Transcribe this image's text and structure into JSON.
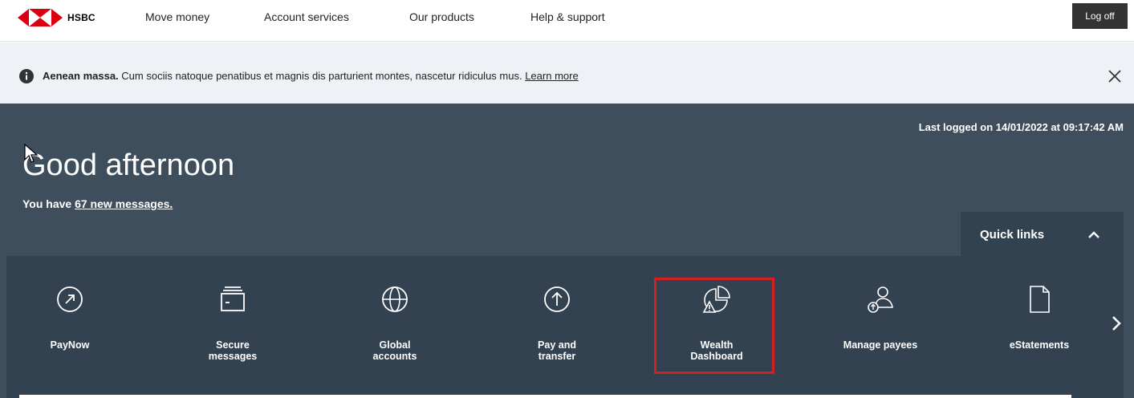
{
  "brand": {
    "name": "HSBC",
    "colors": {
      "red": "#db0011",
      "dark": "#333333",
      "hero": "#3e4e5c",
      "panel": "#334250"
    }
  },
  "nav": {
    "items": [
      {
        "label": "Move money"
      },
      {
        "label": "Account services"
      },
      {
        "label": "Our products"
      },
      {
        "label": "Help & support"
      }
    ],
    "logoff_label": "Log off"
  },
  "notice": {
    "bold_text": "Aenean massa.",
    "text": " Cum sociis natoque penatibus et magnis dis parturient montes, nascetur ridiculus mus. ",
    "link_text": "Learn more",
    "icon": "info-icon",
    "close_icon": "close-icon"
  },
  "hero": {
    "last_logged": "Last logged on 14/01/2022 at 09:17:42 AM",
    "greeting": "Good afternoon",
    "messages_prefix": "You have ",
    "messages_link": "67 new messages."
  },
  "quick_links": {
    "label": "Quick links",
    "items": [
      {
        "label": "PayNow",
        "icon": "paynow-icon"
      },
      {
        "label": "Secure\nmessages",
        "icon": "inbox-icon"
      },
      {
        "label": "Global\naccounts",
        "icon": "globe-icon"
      },
      {
        "label": "Pay and\ntransfer",
        "icon": "arrow-up-circle-icon"
      },
      {
        "label": "Wealth\nDashboard",
        "icon": "pie-chart-warning-icon"
      },
      {
        "label": "Manage payees",
        "icon": "payee-icon"
      },
      {
        "label": "eStatements",
        "icon": "document-icon"
      }
    ]
  }
}
